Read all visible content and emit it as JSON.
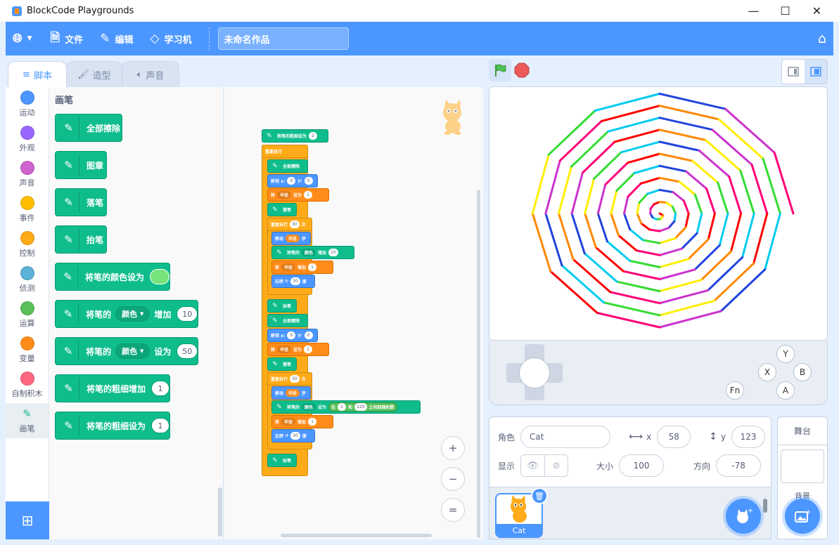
{
  "window": {
    "title": "BlockCode Playgrounds",
    "minimize": "—",
    "maximize": "☐",
    "close": "✕"
  },
  "menubar": {
    "language_icon": "globe-icon",
    "file": "文件",
    "edit": "编辑",
    "learning": "学习机",
    "project_title": "未命名作品",
    "accent_color": "#4c97ff"
  },
  "tabs": [
    {
      "label": "脚本",
      "icon": "code-icon"
    },
    {
      "label": "造型",
      "icon": "brush-icon"
    },
    {
      "label": "声音",
      "icon": "speaker-icon"
    }
  ],
  "categories": [
    {
      "label": "运动",
      "color": "#4c97ff"
    },
    {
      "label": "外观",
      "color": "#9966ff"
    },
    {
      "label": "声音",
      "color": "#cf63cf"
    },
    {
      "label": "事件",
      "color": "#ffbf00"
    },
    {
      "label": "控制",
      "color": "#ffab19"
    },
    {
      "label": "侦测",
      "color": "#5cb1d6"
    },
    {
      "label": "运算",
      "color": "#59c059"
    },
    {
      "label": "变量",
      "color": "#ff8c1a"
    },
    {
      "label": "自制积木",
      "color": "#ff6680"
    },
    {
      "label": "画笔",
      "color": "#0fbd8c"
    }
  ],
  "palette": {
    "title": "画笔",
    "blocks": {
      "clear": "全部擦除",
      "stamp": "图章",
      "pen_down": "落笔",
      "pen_up": "抬笔",
      "set_color_to": "将笔的颜色设为",
      "change_param_prefix": "将笔的",
      "change_param_option": "颜色",
      "change_param_suffix": "增加",
      "change_param_value": "10",
      "set_param_prefix": "将笔的",
      "set_param_option": "颜色",
      "set_param_suffix": "设为",
      "set_param_value": "50",
      "change_size": "将笔的粗细增加",
      "change_size_value": "1",
      "set_size": "将笔的粗细设为",
      "set_size_value": "1"
    }
  },
  "script": {
    "set_size": "将笔的粗细设为",
    "set_size_v": "2",
    "forever": "重复执行",
    "clear": "全部擦除",
    "goto": "移到 x:",
    "goto_x": "0",
    "goto_y_label": "y:",
    "goto_y": "0",
    "set_var": "将",
    "var_name": "半径",
    "set_to": "设为",
    "var_v1": "1",
    "pen_down": "落笔",
    "repeat": "重复执行",
    "repeat_n": "30",
    "repeat_times": "次",
    "move": "移动",
    "steps": "步",
    "change_color_prefix": "将笔的",
    "color_opt": "颜色",
    "change": "增加",
    "color_inc": "10",
    "change_var_label": "将",
    "change_by": "增加",
    "var_inc": "1",
    "turn_right": "右转",
    "turn_deg": "30",
    "deg": "度",
    "pen_up": "抬笔",
    "turn_left": "左转",
    "rand_prefix": "在",
    "rand_from": "1",
    "rand_and": "和",
    "rand_to": "120",
    "rand_suffix": "之间取随机数",
    "set_label": "设为"
  },
  "zoom": {
    "in": "+",
    "out": "−",
    "reset": "="
  },
  "stage": {
    "spiral_colors": [
      "#ff0000",
      "#ff8800",
      "#ffee00",
      "#33dd33",
      "#00ccee",
      "#2244dd",
      "#cc33cc",
      "#ff0077"
    ],
    "buttons": {
      "y": "Y",
      "x": "X",
      "b": "B",
      "a": "A",
      "fn": "Fn"
    }
  },
  "sprite_info": {
    "label_sprite": "角色",
    "sprite_name": "Cat",
    "x_label": "x",
    "x_value": "58",
    "y_label": "y",
    "y_value": "123",
    "show_label": "显示",
    "size_label": "大小",
    "size_value": "100",
    "direction_label": "方向",
    "direction_value": "-78"
  },
  "sprites": [
    {
      "name": "Cat"
    }
  ],
  "stage_pane": {
    "title": "舞台",
    "backdrop_label": "背景"
  }
}
